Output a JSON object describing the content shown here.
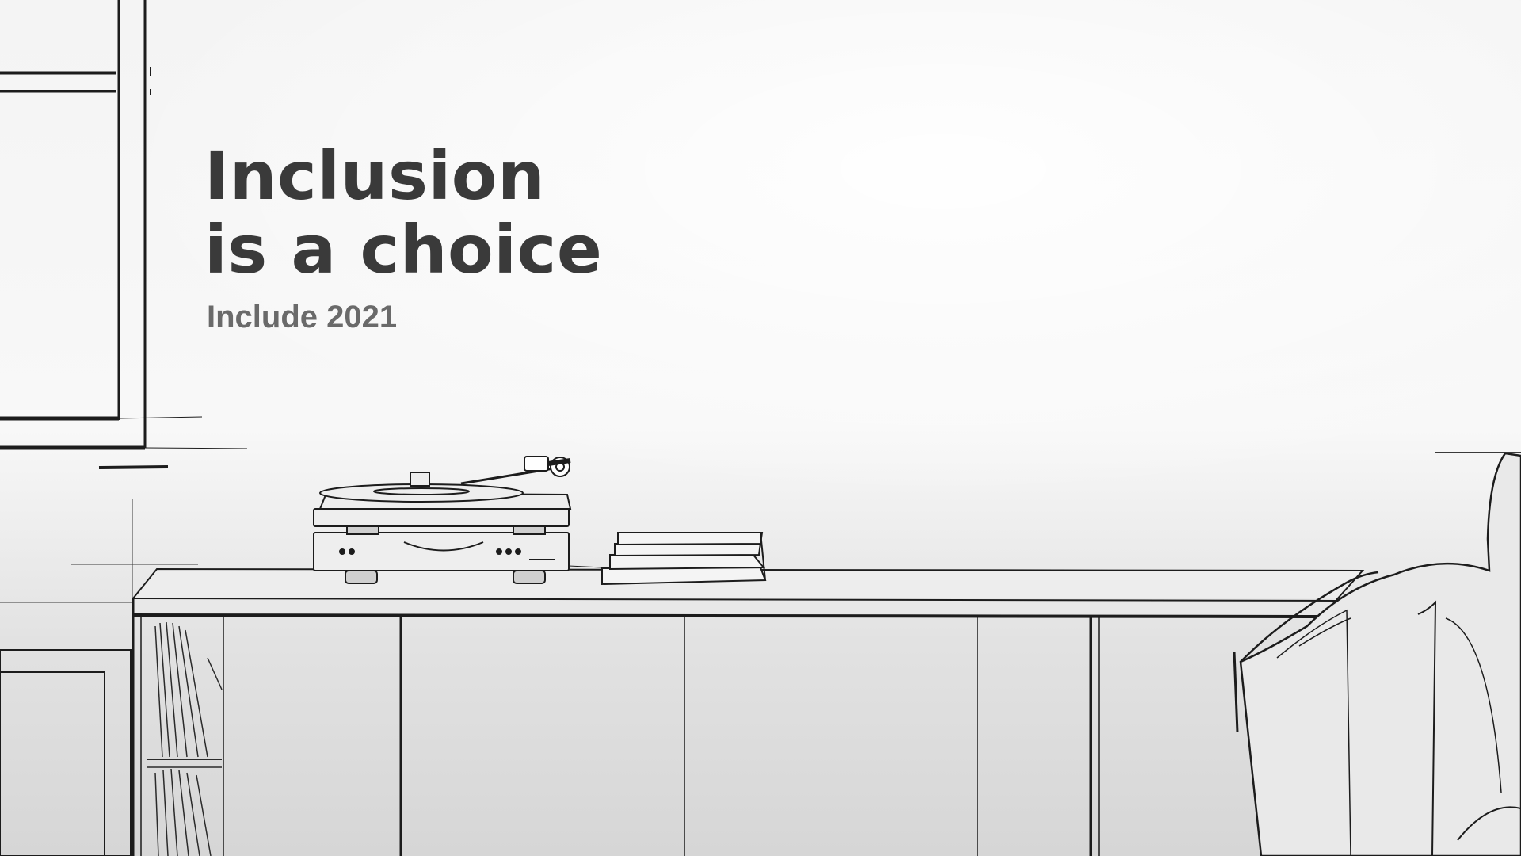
{
  "hero": {
    "title_line1": "Inclusion",
    "title_line2": "is a choice",
    "subtitle": "Include 2021"
  },
  "colors": {
    "background": "#f1f1f1",
    "title": "#3a3a3a",
    "subtitle": "#6a6a6a",
    "ink": "#1c1c1c"
  },
  "scene": {
    "icons": [
      "window-frame-icon",
      "turntable-icon",
      "book-stack-icon",
      "sideboard-cabinet-icon",
      "record-shelf-icon",
      "armchair-icon"
    ]
  }
}
